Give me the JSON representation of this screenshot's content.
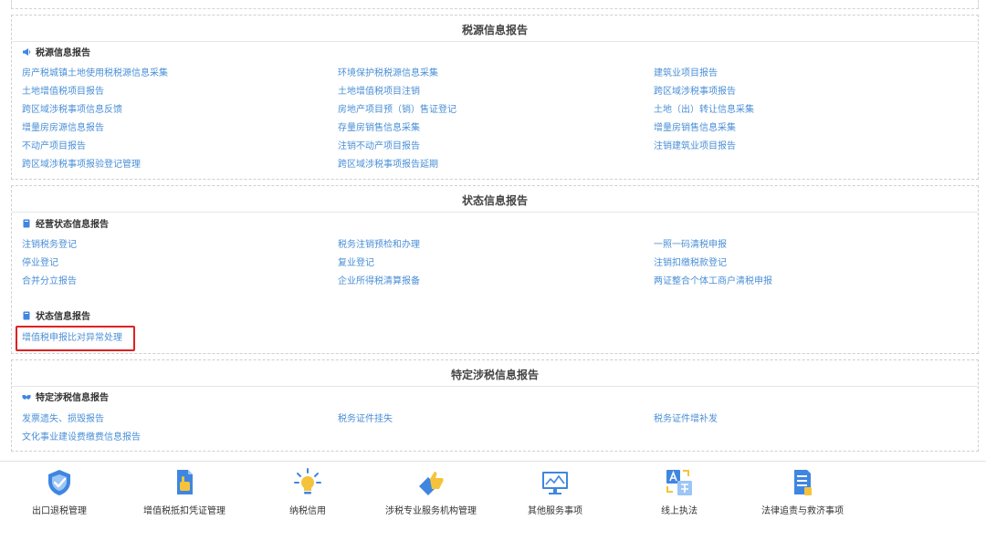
{
  "sections": [
    {
      "title": "税源信息报告",
      "groups": [
        {
          "title": "税源信息报告",
          "icon": "megaphone-icon",
          "items": [
            "房产税城镇土地使用税税源信息采集",
            "环境保护税税源信息采集",
            "建筑业项目报告",
            "土地增值税项目报告",
            "土地增值税项目注销",
            "跨区域涉税事项报告",
            "跨区域涉税事项信息反馈",
            "房地产项目预（销）售证登记",
            "土地（出）转让信息采集",
            "增量房房源信息报告",
            "存量房销售信息采集",
            "增量房销售信息采集",
            "不动产项目报告",
            "注销不动产项目报告",
            "注销建筑业项目报告",
            "跨区域涉税事项报验登记管理",
            "跨区域涉税事项报告延期"
          ]
        }
      ]
    },
    {
      "title": "状态信息报告",
      "groups": [
        {
          "title": "经营状态信息报告",
          "icon": "book-icon",
          "items": [
            "注销税务登记",
            "税务注销预检和办理",
            "一照一码清税申报",
            "停业登记",
            "复业登记",
            "注销扣缴税款登记",
            "合并分立报告",
            "企业所得税清算报备",
            "两证整合个体工商户清税申报"
          ]
        },
        {
          "title": "状态信息报告",
          "icon": "book-icon",
          "items": [
            "增值税申报比对异常处理"
          ]
        }
      ]
    },
    {
      "title": "特定涉税信息报告",
      "groups": [
        {
          "title": "特定涉税信息报告",
          "icon": "handshake-icon",
          "items": [
            "发票遗失、损毁报告",
            "税务证件挂失",
            "税务证件增补发",
            "文化事业建设费缴费信息报告"
          ]
        }
      ]
    }
  ],
  "bottom_nav": [
    {
      "label": "出口退税管理",
      "icon": "shield-check-icon"
    },
    {
      "label": "增值税抵扣凭证管理",
      "icon": "document-hand-icon"
    },
    {
      "label": "纳税信用",
      "icon": "lightbulb-icon"
    },
    {
      "label": "涉税专业服务机构管理",
      "icon": "thumbs-up-icon"
    },
    {
      "label": "其他服务事项",
      "icon": "monitor-chart-icon"
    },
    {
      "label": "线上执法",
      "icon": "translate-icon"
    },
    {
      "label": "法律追责与救济事项",
      "icon": "document-list-icon"
    }
  ],
  "colors": {
    "link": "#4a8fd6",
    "icon_blue": "#3f86e0",
    "highlight": "#e02020"
  }
}
